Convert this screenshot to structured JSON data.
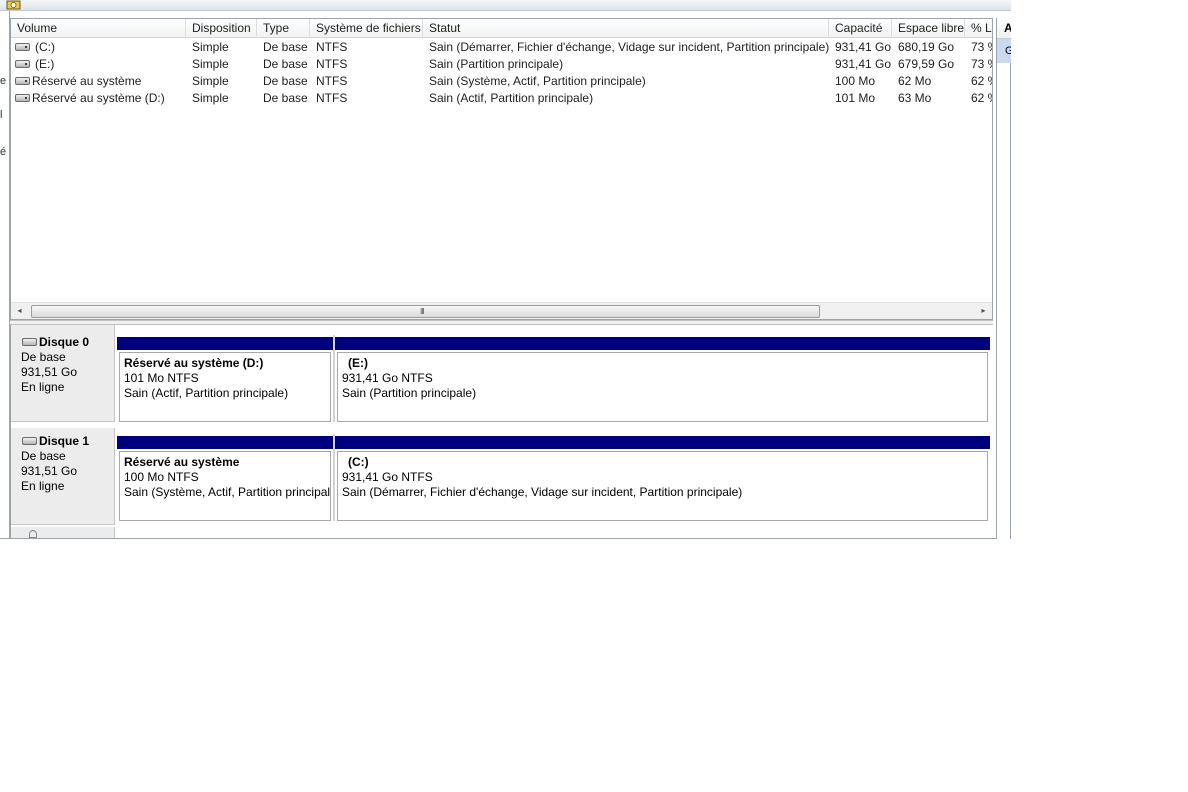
{
  "columns": [
    "Volume",
    "Disposition",
    "Type",
    "Système de fichiers",
    "Statut",
    "Capacité",
    "Espace libre",
    "% L"
  ],
  "rows": [
    {
      "volume": "(C:)",
      "disposition": "Simple",
      "type": "De base",
      "fs": "NTFS",
      "status": "Sain (Démarrer, Fichier d'échange, Vidage sur incident, Partition principale)",
      "capacity": "931,41 Go",
      "free": "680,19 Go",
      "pct": "73 %"
    },
    {
      "volume": "(E:)",
      "disposition": "Simple",
      "type": "De base",
      "fs": "NTFS",
      "status": "Sain (Partition principale)",
      "capacity": "931,41 Go",
      "free": "679,59 Go",
      "pct": "73 %"
    },
    {
      "volume": "Réservé au système",
      "disposition": "Simple",
      "type": "De base",
      "fs": "NTFS",
      "status": "Sain (Système, Actif, Partition principale)",
      "capacity": "100 Mo",
      "free": "62 Mo",
      "pct": "62 %"
    },
    {
      "volume": "Réservé au système (D:)",
      "disposition": "Simple",
      "type": "De base",
      "fs": "NTFS",
      "status": "Sain (Actif, Partition principale)",
      "capacity": "101 Mo",
      "free": "63 Mo",
      "pct": "62 %"
    }
  ],
  "left_gutter_chars": [
    "e",
    "l",
    "é"
  ],
  "scrollbar": {
    "left_arrow": "◂",
    "right_arrow": "▸",
    "grip": "III"
  },
  "disks": [
    {
      "name": "Disque 0",
      "kind": "De base",
      "size": "931,51 Go",
      "state": "En ligne",
      "partitions": [
        {
          "title": "Réservé au système  (D:)",
          "size_fs": "101 Mo NTFS",
          "status": "Sain (Actif, Partition principale)"
        },
        {
          "title": "(E:)",
          "size_fs": "931,41 Go NTFS",
          "status": "Sain (Partition principale)"
        }
      ]
    },
    {
      "name": "Disque 1",
      "kind": "De base",
      "size": "931,51 Go",
      "state": "En ligne",
      "partitions": [
        {
          "title": "Réservé au système",
          "size_fs": "100 Mo NTFS",
          "status": "Sain (Système, Actif, Partition principal"
        },
        {
          "title": "(C:)",
          "size_fs": "931,41 Go NTFS",
          "status": "Sain (Démarrer, Fichier d'échange, Vidage sur incident, Partition principale)"
        }
      ]
    }
  ],
  "actions_panel": {
    "header": "A",
    "item": "G"
  },
  "colors": {
    "partition_bar": "#00007c",
    "selection": "#c9d9ee",
    "label_bg": "#ececec"
  }
}
